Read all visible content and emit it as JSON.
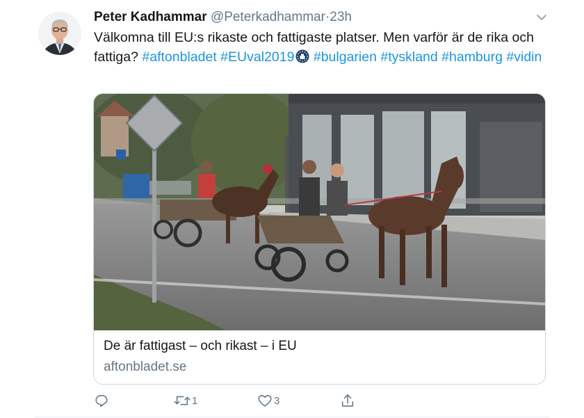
{
  "tweet": {
    "author_name": "Peter Kadhammar",
    "handle": "@Peterkadhammar",
    "separator": "·",
    "time": "23h",
    "text_intro": "Välkomna till EU:s rikaste och fattigaste platser. Men varför är de rika och fattiga? ",
    "hashtags": [
      "#aftonbladet",
      "#EUval2019",
      "#bulgarien",
      "#tyskland",
      "#hamburg",
      "#vidin"
    ]
  },
  "card": {
    "title": "De är fattigast – och rikast – i EU",
    "domain": "aftonbladet.se"
  },
  "actions": {
    "reply_count": "",
    "retweet_count": "1",
    "like_count": "3"
  },
  "colors": {
    "link": "#1b95e0",
    "secondary_text": "#657786",
    "primary_text": "#14171a",
    "border": "#ccd6dd"
  },
  "icons": [
    "reply-icon",
    "retweet-icon",
    "like-icon",
    "share-icon",
    "chevron-down-icon",
    "eu-ballot-box-emoji"
  ]
}
